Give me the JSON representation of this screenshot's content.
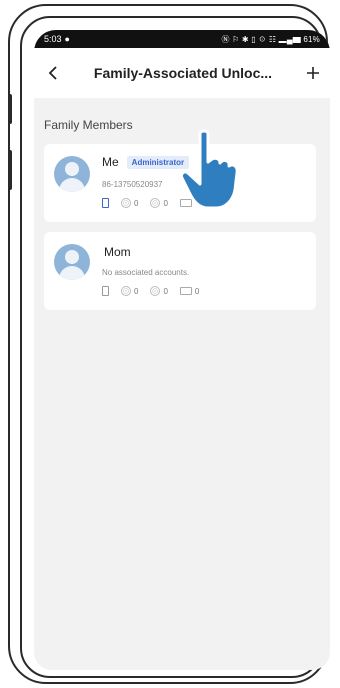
{
  "status_bar": {
    "time": "5:03",
    "right_icons": "Ⓝ ⚐ ✱ ▯ ☉ ☷ ▂▄▆",
    "battery": "61%"
  },
  "nav": {
    "title": "Family-Associated Unloc...",
    "back_icon": "chevron-left-icon",
    "add_icon": "plus-icon"
  },
  "section_label": "Family Members",
  "members": [
    {
      "name": "Me",
      "badge": "Administrator",
      "subtitle": "86-13750520937",
      "fingerprint_count": "0",
      "face_count": "0",
      "card_count": "",
      "phone_active": true
    },
    {
      "name": "Mom",
      "badge": "",
      "subtitle": "No associated accounts.",
      "fingerprint_count": "0",
      "face_count": "0",
      "card_count": "0",
      "phone_active": false
    }
  ],
  "colors": {
    "accent": "#3a66c8",
    "avatar": "#8fb4d9",
    "background": "#f2f2f2",
    "hand": "#2f7fc0"
  }
}
